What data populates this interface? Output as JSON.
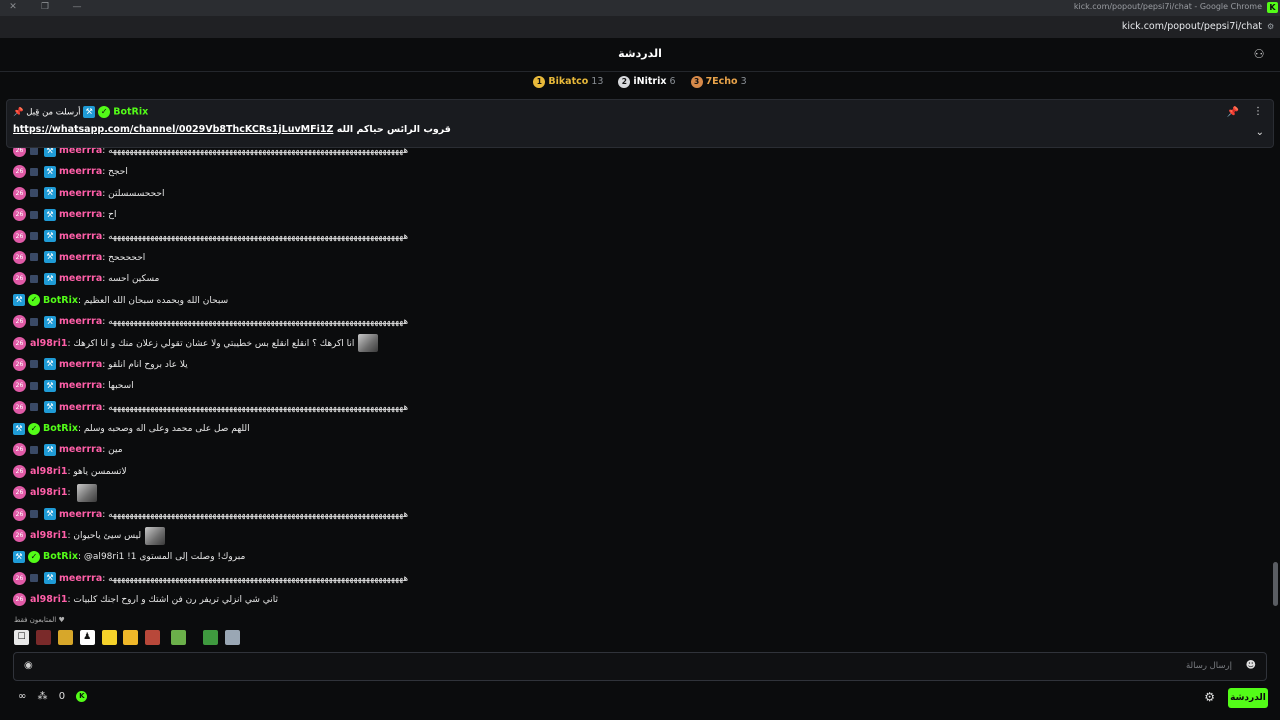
{
  "window": {
    "title": "kick.com/popout/pepsi7i/chat - Google Chrome",
    "url": "kick.com/popout/pepsi7i/chat"
  },
  "header": {
    "title": "الدردشة"
  },
  "leaderboard": [
    {
      "rank": "1",
      "name": "Bikatco",
      "count": "13",
      "color": "#e8b93a"
    },
    {
      "rank": "2",
      "name": "iNitrix",
      "count": "6",
      "color": "#d7d9dc"
    },
    {
      "rank": "3",
      "name": "7Echo",
      "count": "3",
      "color": "#d78a4a"
    }
  ],
  "pinned": {
    "label": "أرسلت من قِبل",
    "author": "BotRix",
    "text": "قروب الرائس حياكم الله",
    "link": "https://whatsapp.com/channel/0029Vb8ThcKCRs1jLuvMFi1Z"
  },
  "colors": {
    "botrix": "#53fc18",
    "meerrra": "#ff5fa8",
    "al98ri1": "#ff5fa8",
    "accent": "#53fc18"
  },
  "messages": [
    {
      "user": "meerrra",
      "text": "هههههههههههههههههههههههههههههههههههههههههههههههههههههههههههههههههههههههه",
      "type": "mod"
    },
    {
      "user": "meerrra",
      "text": "احجح",
      "type": "mod"
    },
    {
      "user": "meerrra",
      "text": "احححسسسلتن",
      "type": "mod"
    },
    {
      "user": "meerrra",
      "text": "اح",
      "type": "mod"
    },
    {
      "user": "meerrra",
      "text": "هههههههههههههههههههههههههههههههههههههههههههههههههههههههههههههههههههههههه",
      "type": "mod"
    },
    {
      "user": "meerrra",
      "text": "احححححح",
      "type": "mod"
    },
    {
      "user": "meerrra",
      "text": "مسكين احسه",
      "type": "mod"
    },
    {
      "user": "BotRix",
      "text": "سبحان الله وبحمده سبحان الله العظيم",
      "type": "bot"
    },
    {
      "user": "meerrra",
      "text": "هههههههههههههههههههههههههههههههههههههههههههههههههههههههههههههههههههههههه",
      "type": "mod"
    },
    {
      "user": "al98ri1",
      "text": "انا اكرهك ؟ انقلع انقلع بس خطيبتي ولا عشان تقولي زعلان منك و انا اكرهك",
      "type": "sub",
      "emote": true
    },
    {
      "user": "meerrra",
      "text": "يلا عاد بروح انام انلقو",
      "type": "mod"
    },
    {
      "user": "meerrra",
      "text": "اسحبها",
      "type": "mod"
    },
    {
      "user": "meerrra",
      "text": "هههههههههههههههههههههههههههههههههههههههههههههههههههههههههههههههههههههههه",
      "type": "mod"
    },
    {
      "user": "BotRix",
      "text": "اللهم صل على محمد وعلى اله وصحبه وسلم",
      "type": "bot"
    },
    {
      "user": "meerrra",
      "text": "مين",
      "type": "mod"
    },
    {
      "user": "al98ri1",
      "text": "لاتسمسن ياهو",
      "type": "sub"
    },
    {
      "user": "al98ri1",
      "text": "",
      "type": "sub",
      "emote": true
    },
    {
      "user": "meerrra",
      "text": "هههههههههههههههههههههههههههههههههههههههههههههههههههههههههههههههههههههههه",
      "type": "mod"
    },
    {
      "user": "al98ri1",
      "text": "ليس سيئ ياحيوان",
      "type": "sub",
      "emote": true
    },
    {
      "user": "BotRix",
      "text": "@al98ri1 !مبروك! وصلت إلى المستوى 1",
      "type": "bot"
    },
    {
      "user": "meerrra",
      "text": "هههههههههههههههههههههههههههههههههههههههههههههههههههههههههههههههههههههههه",
      "type": "mod"
    },
    {
      "user": "al98ri1",
      "text": "ثاني شي انزلي تريفر رن فن اشتك و اروح اجنك كلبيات",
      "type": "sub"
    }
  ],
  "emote_bar": {
    "label": "المتابعون فقط",
    "items": [
      "a",
      "b",
      "c",
      "d",
      "e",
      "f",
      "g",
      "h",
      "i",
      "j"
    ]
  },
  "input": {
    "placeholder": "إرسال رسالة"
  },
  "footer": {
    "count": "0",
    "send_label": "الدردشة"
  }
}
